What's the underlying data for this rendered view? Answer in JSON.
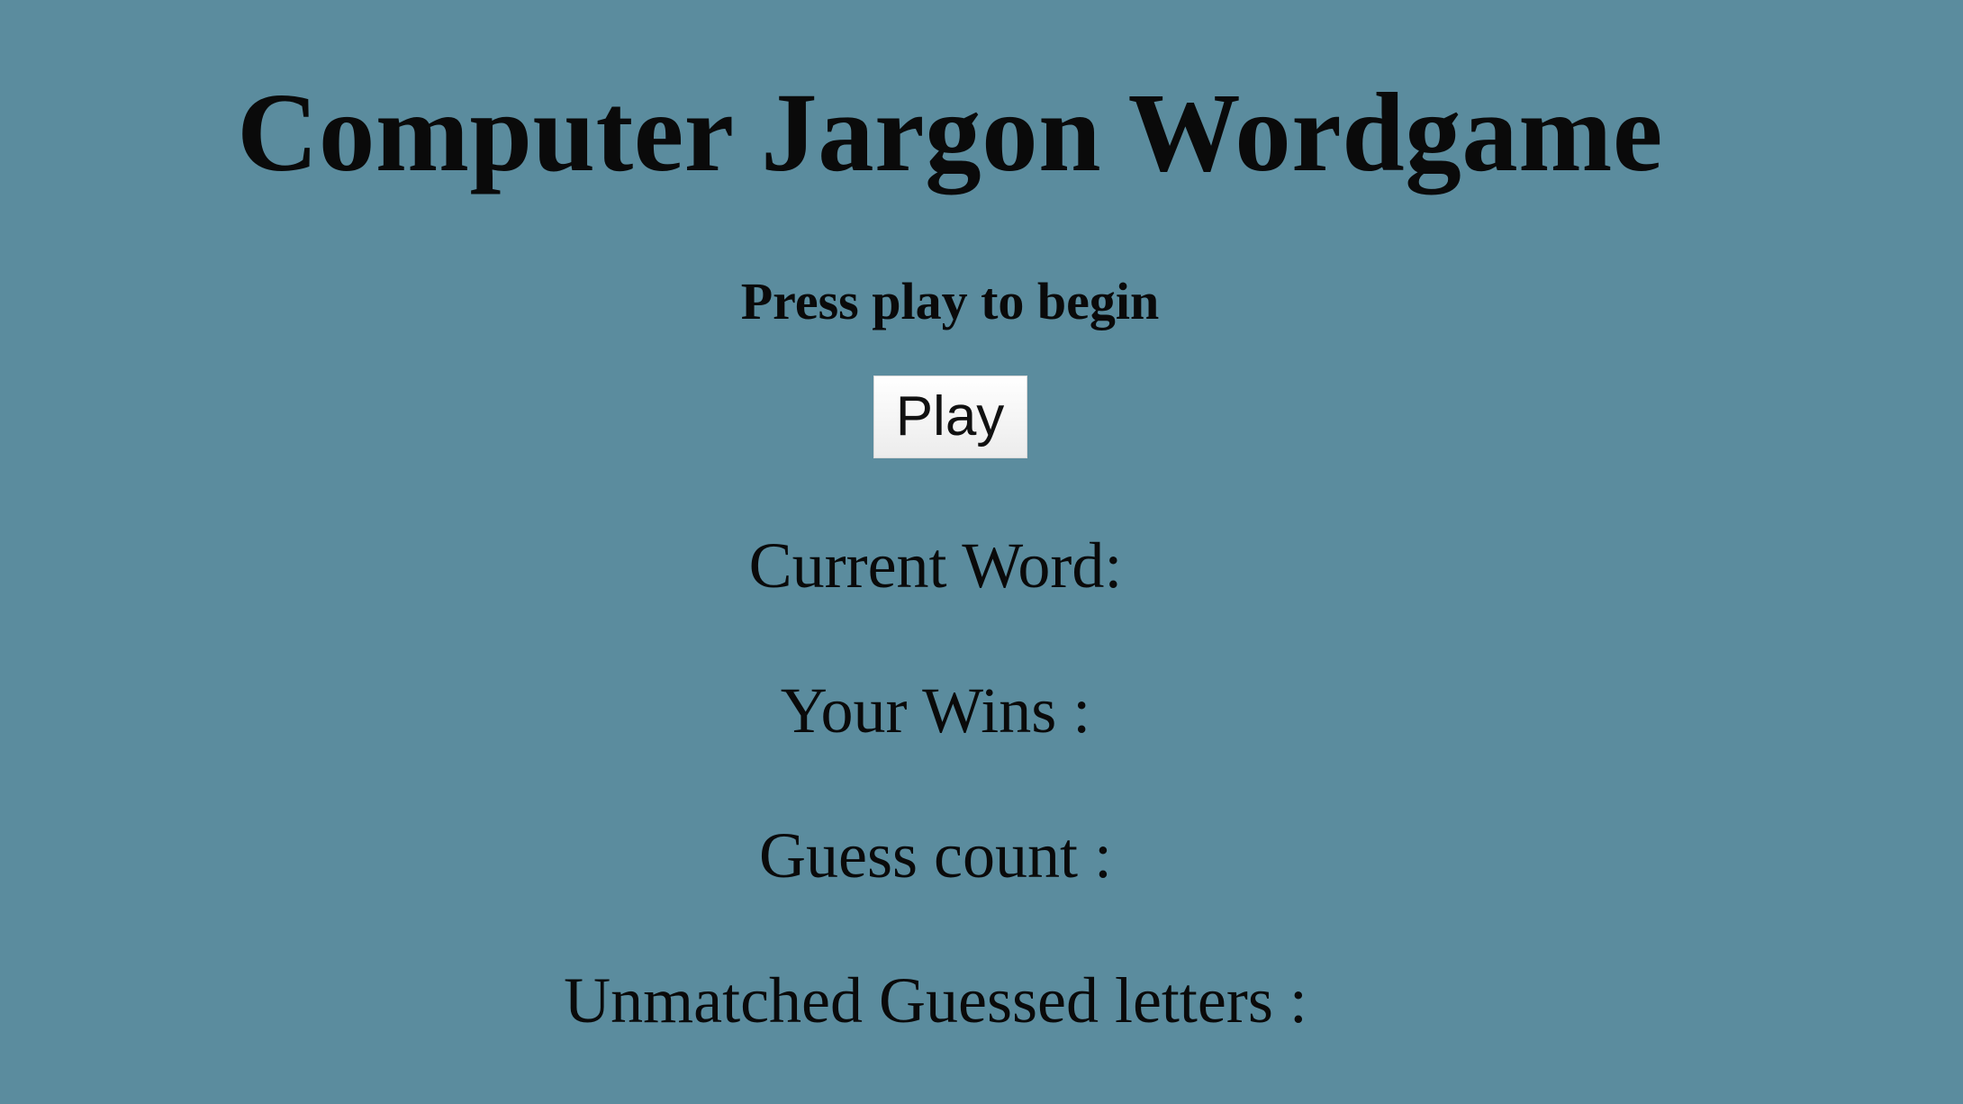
{
  "game": {
    "title": "Computer Jargon Wordgame",
    "instructions": "Press play to begin",
    "play_label": "Play"
  },
  "stats": {
    "current_word_label": "Current Word:",
    "current_word_value": "",
    "wins_label": "Your Wins :",
    "wins_value": "",
    "guess_count_label": "Guess count :",
    "guess_count_value": "",
    "unmatched_label": "Unmatched Guessed letters :",
    "unmatched_value": ""
  },
  "colors": {
    "background": "#5b8c9e",
    "text": "#0a0a0a"
  }
}
